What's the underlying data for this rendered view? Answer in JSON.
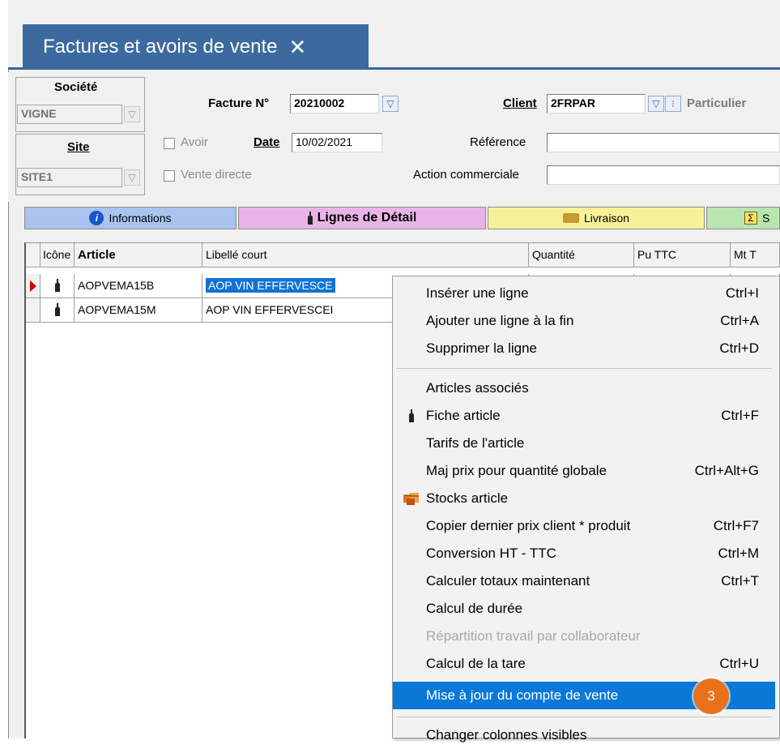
{
  "window": {
    "tab_title": "Factures et avoirs de vente",
    "close_glyph": "✕"
  },
  "form": {
    "societe_label": "Société",
    "societe_value": "VIGNE",
    "site_label": "Site",
    "site_value": "SITE1",
    "facture_label": "Facture N°",
    "facture_value": "20210002",
    "avoir_label": "Avoir",
    "vente_directe_label": "Vente directe",
    "date_label": "Date",
    "date_value": "10/02/2021",
    "client_label": "Client",
    "client_value": "2FRPAR",
    "client_type": "Particulier",
    "reference_label": "Référence",
    "reference_value": "",
    "action_label": "Action commerciale",
    "action_value": ""
  },
  "section_tabs": [
    {
      "label": "Informations",
      "icon": "info-icon",
      "color": "#a9c4ee"
    },
    {
      "label": "Lignes de Détail",
      "icon": "bottle-icon",
      "color": "#e8b4e8"
    },
    {
      "label": "Livraison",
      "icon": "truck-icon",
      "color": "#f7f29a"
    },
    {
      "label": "S",
      "icon": "sigma-icon",
      "color": "#b9e6b0"
    }
  ],
  "grid": {
    "columns": [
      "Icône",
      "Article",
      "Libellé court",
      "Quantité",
      "Pu TTC",
      "Mt T"
    ],
    "rows": [
      {
        "icon": "bottle-icon",
        "article": "AOPVEMA15B",
        "libelle": "AOP VIN EFFERVESCE",
        "selected": true
      },
      {
        "icon": "bottle-icon",
        "article": "AOPVEMA15M",
        "libelle": "AOP VIN EFFERVESCEI",
        "selected": false
      }
    ]
  },
  "context_menu": {
    "items": [
      {
        "label": "Insérer une ligne",
        "shortcut": "Ctrl+I"
      },
      {
        "label": "Ajouter une ligne à la fin",
        "shortcut": "Ctrl+A"
      },
      {
        "label": "Supprimer la ligne",
        "shortcut": "Ctrl+D"
      },
      {
        "label": "Articles associés",
        "shortcut": ""
      },
      {
        "label": "Fiche article",
        "shortcut": "Ctrl+F",
        "icon": "bottle-icon"
      },
      {
        "label": "Tarifs de l'article",
        "shortcut": ""
      },
      {
        "label": "Maj prix pour quantité globale",
        "shortcut": "Ctrl+Alt+G"
      },
      {
        "label": "Stocks article",
        "shortcut": "",
        "icon": "boxes-icon"
      },
      {
        "label": "Copier dernier prix client * produit",
        "shortcut": "Ctrl+F7"
      },
      {
        "label": "Conversion HT - TTC",
        "shortcut": "Ctrl+M"
      },
      {
        "label": "Calculer totaux maintenant",
        "shortcut": "Ctrl+T"
      },
      {
        "label": "Calcul de durée",
        "shortcut": ""
      },
      {
        "label": "Répartition travail par collaborateur",
        "shortcut": "",
        "disabled": true
      },
      {
        "label": "Calcul de la tare",
        "shortcut": "Ctrl+U"
      },
      {
        "label": "Mise à jour du compte de vente",
        "shortcut": "",
        "highlighted": true
      },
      {
        "label": "Changer colonnes visibles",
        "shortcut": ""
      }
    ]
  },
  "step_badge": "3",
  "colors": {
    "accent": "#3c6a9e",
    "menu_highlight": "#0a78d7",
    "badge": "#e8711c",
    "selection": "#1173d4"
  }
}
